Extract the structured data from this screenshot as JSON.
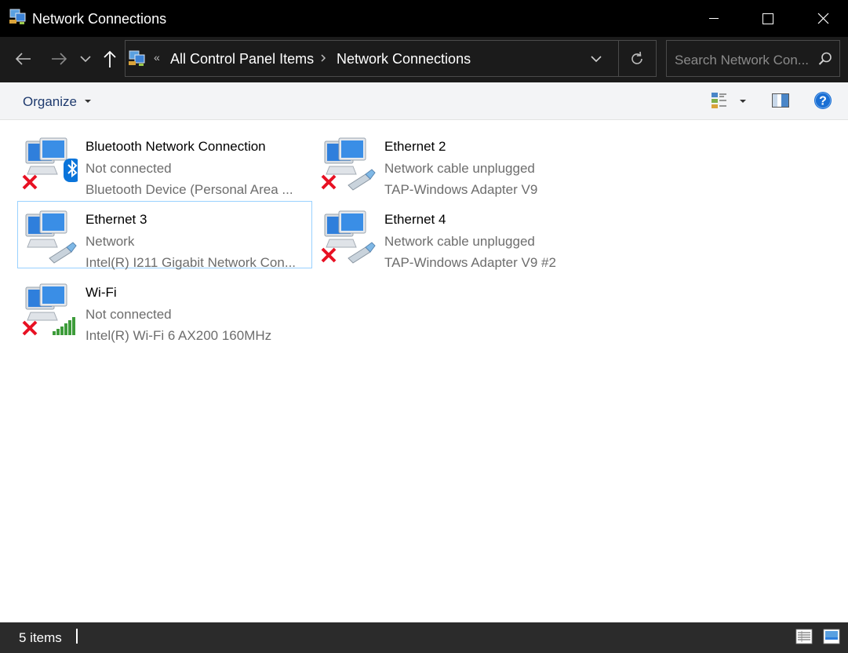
{
  "window": {
    "title": "Network Connections",
    "controls": [
      "minimize",
      "maximize",
      "close"
    ]
  },
  "address": {
    "overflow": "«",
    "crumbs": [
      "All Control Panel Items",
      "Network Connections"
    ],
    "search_placeholder": "Search Network Con..."
  },
  "toolbar": {
    "organize_label": "Organize"
  },
  "items": [
    {
      "name": "Bluetooth Network Connection",
      "status": "Not connected",
      "device": "Bluetooth Device (Personal Area ...",
      "icon": "bluetooth-connection-icon",
      "disconnected": true
    },
    {
      "name": "Ethernet 2",
      "status": "Network cable unplugged",
      "device": "TAP-Windows Adapter V9",
      "icon": "ethernet-connection-icon",
      "disconnected": true
    },
    {
      "name": "Ethernet 3",
      "status": "Network",
      "device": "Intel(R) I211 Gigabit Network Con...",
      "icon": "ethernet-connection-icon",
      "disconnected": false,
      "selected": true
    },
    {
      "name": "Ethernet 4",
      "status": "Network cable unplugged",
      "device": "TAP-Windows Adapter V9 #2",
      "icon": "ethernet-connection-icon",
      "disconnected": true
    },
    {
      "name": "Wi-Fi",
      "status": "Not connected",
      "device": "Intel(R) Wi-Fi 6 AX200 160MHz",
      "icon": "wifi-connection-icon",
      "disconnected": true
    }
  ],
  "statusbar": {
    "count": "5 items"
  },
  "colors": {
    "titlebar": "#000000",
    "addressbar": "#1b1b1b",
    "selection_border": "#99d1ff",
    "error_red": "#e81123",
    "link_blue": "#1e3a6e"
  }
}
